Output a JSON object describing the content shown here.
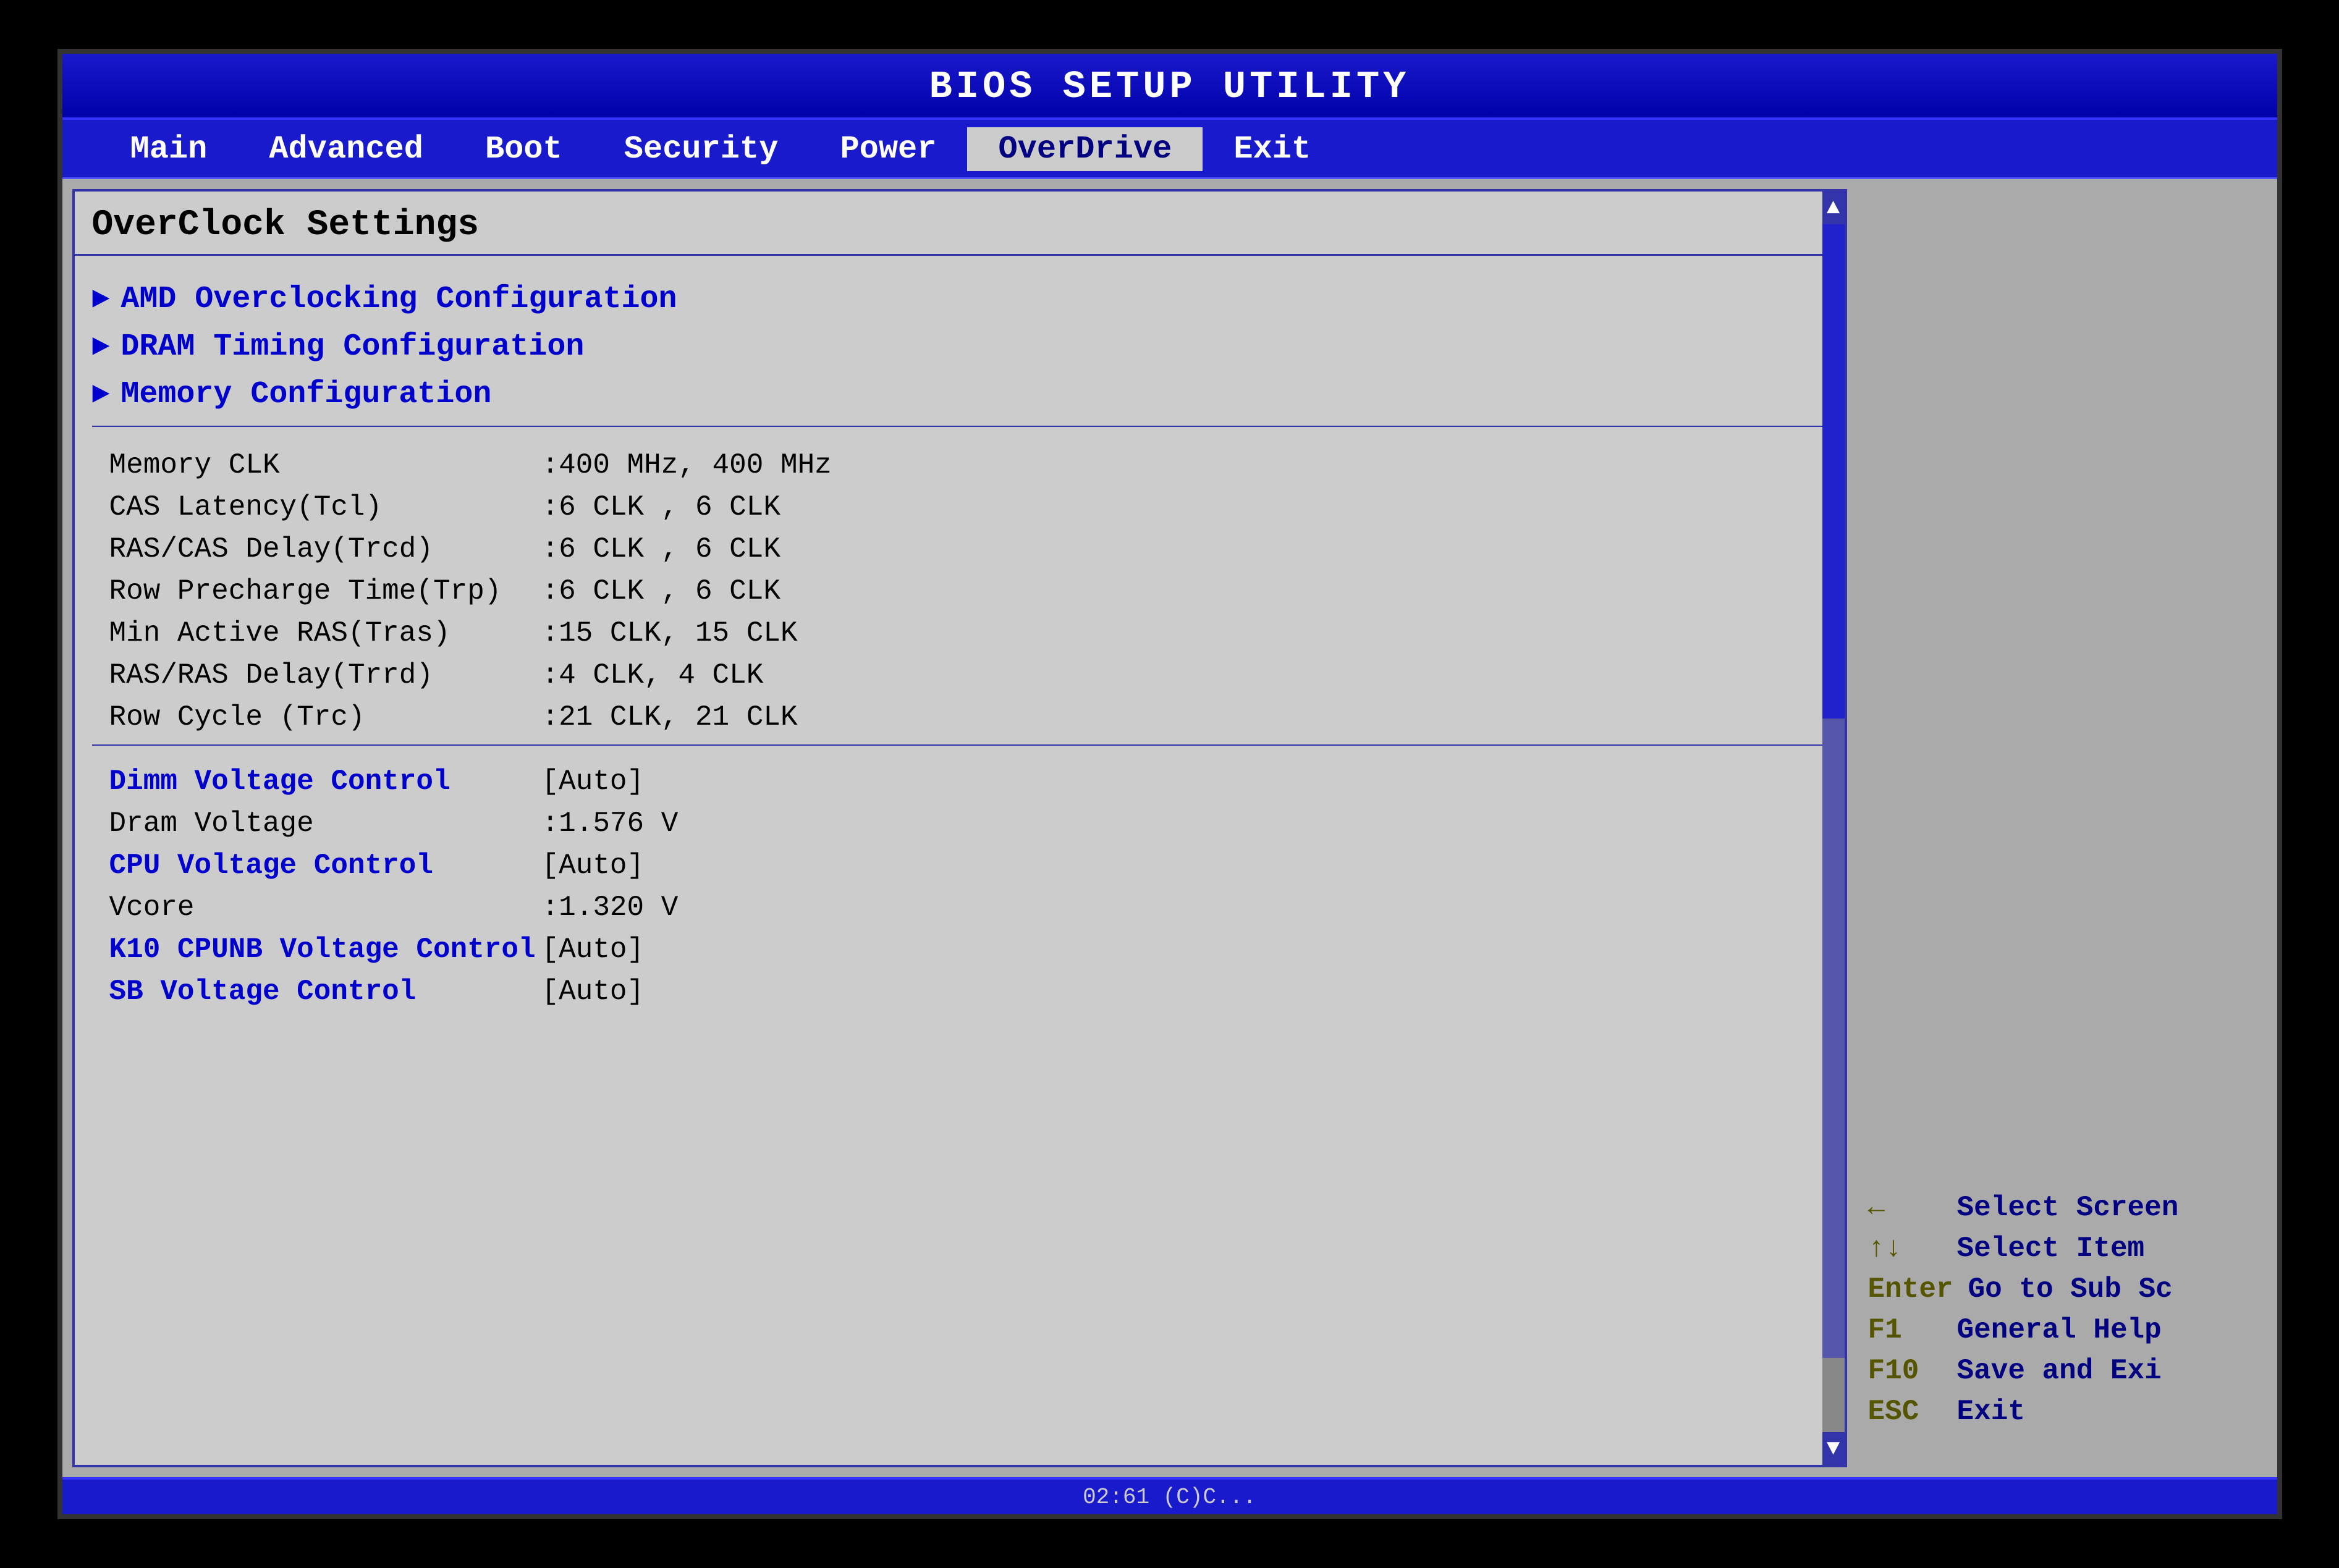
{
  "title": "BIOS SETUP UTILITY",
  "menu": {
    "items": [
      {
        "label": "Main",
        "active": false
      },
      {
        "label": "Advanced",
        "active": false
      },
      {
        "label": "Boot",
        "active": false
      },
      {
        "label": "Security",
        "active": false
      },
      {
        "label": "Power",
        "active": false
      },
      {
        "label": "OverDrive",
        "active": true
      },
      {
        "label": "Exit",
        "active": false
      }
    ]
  },
  "panel": {
    "title": "OverClock Settings",
    "subMenuItems": [
      {
        "label": "AMD Overclocking Configuration"
      },
      {
        "label": "DRAM Timing Configuration"
      },
      {
        "label": "Memory Configuration"
      }
    ],
    "infoRows": [
      {
        "label": "Memory CLK",
        "value": ":400 MHz, 400 MHz"
      },
      {
        "label": "CAS Latency(Tcl)",
        "value": ":6 CLK , 6 CLK"
      },
      {
        "label": "RAS/CAS Delay(Trcd)",
        "value": ":6 CLK , 6 CLK"
      },
      {
        "label": "Row Precharge Time(Trp)",
        "value": ":6 CLK , 6 CLK"
      },
      {
        "label": "Min Active RAS(Tras)",
        "value": ":15 CLK, 15 CLK"
      },
      {
        "label": "RAS/RAS Delay(Trrd)",
        "value": ":4 CLK, 4 CLK"
      },
      {
        "label": "Row Cycle (Trc)",
        "value": ":21 CLK, 21 CLK"
      }
    ],
    "voltageRows": [
      {
        "label": "Dimm Voltage Control",
        "blue": true,
        "value": "[Auto]"
      },
      {
        "label": "Dram Voltage",
        "blue": false,
        "value": ":1.576 V"
      },
      {
        "label": "CPU Voltage Control",
        "blue": true,
        "value": "[Auto]"
      },
      {
        "label": "Vcore",
        "blue": false,
        "value": ":1.320 V"
      },
      {
        "label": "K10 CPUNB Voltage Control",
        "blue": true,
        "value": "[Auto]"
      },
      {
        "label": "SB Voltage Control",
        "blue": true,
        "value": "[Auto]"
      }
    ]
  },
  "help": {
    "rows": [
      {
        "key": "←",
        "desc": "Select Screen"
      },
      {
        "key": "↑↓",
        "desc": "Select Item"
      },
      {
        "key": "Enter",
        "desc": "Go to Sub Sc"
      },
      {
        "key": "F1",
        "desc": "General Help"
      },
      {
        "key": "F10",
        "desc": "Save and Exi"
      },
      {
        "key": "ESC",
        "desc": "Exit"
      }
    ]
  },
  "bottomBar": "02:61 (C)C..."
}
